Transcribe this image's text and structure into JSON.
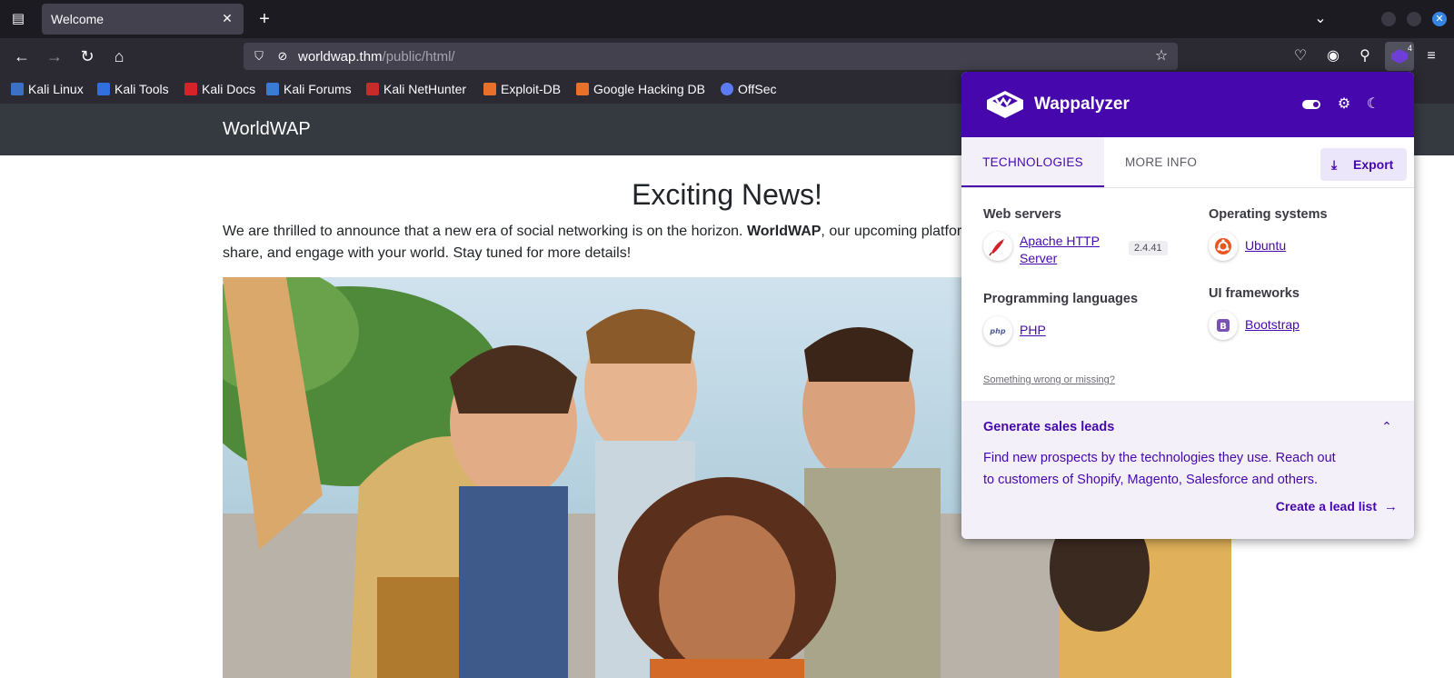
{
  "browser": {
    "tab_title": "Welcome",
    "url_host": "worldwap.thm",
    "url_path": "/public/html/",
    "extension_badge": "4",
    "bookmarks": [
      {
        "label": "Kali Linux",
        "icon": "kali-dragon-icon",
        "color": "#3c6fc6"
      },
      {
        "label": "Kali Tools",
        "icon": "kali-tools-icon",
        "color": "#2f6fe0"
      },
      {
        "label": "Kali Docs",
        "icon": "kali-docs-icon",
        "color": "#d6232a"
      },
      {
        "label": "Kali Forums",
        "icon": "kali-forums-icon",
        "color": "#3a7bd5"
      },
      {
        "label": "Kali NetHunter",
        "icon": "nethunter-icon",
        "color": "#c92a2a"
      },
      {
        "label": "Exploit-DB",
        "icon": "exploit-db-icon",
        "color": "#e8702a"
      },
      {
        "label": "Google Hacking DB",
        "icon": "ghdb-icon",
        "color": "#e8702a"
      },
      {
        "label": "OffSec",
        "icon": "offsec-icon",
        "color": "#5b7cf0"
      }
    ]
  },
  "site": {
    "brand": "WorldWAP",
    "headline": "Exciting News!",
    "para_part1": "We are thrilled to announce that a new era of social networking is on the horizon. ",
    "para_bold": "WorldWAP",
    "para_part2": ", our upcoming platform, will change the way you connect, share, and engage with your world. Stay tuned for more details!",
    "hero_image": "group-of-friends-selfie-photo"
  },
  "wappalyzer": {
    "brand": "Wappalyzer",
    "tabs": [
      "TECHNOLOGIES",
      "MORE INFO"
    ],
    "export_label": "Export",
    "categories": [
      {
        "title": "Web servers",
        "items": [
          {
            "name_line1": "Apache HTTP",
            "name_line2": "Server",
            "version": "2.4.41",
            "icon": "apache-feather-icon"
          }
        ]
      },
      {
        "title": "Operating systems",
        "items": [
          {
            "name": "Ubuntu",
            "icon": "ubuntu-icon"
          }
        ]
      },
      {
        "title": "Programming languages",
        "items": [
          {
            "name": "PHP",
            "icon": "php-icon"
          }
        ]
      },
      {
        "title": "UI frameworks",
        "items": [
          {
            "name": "Bootstrap",
            "icon": "bootstrap-icon"
          }
        ]
      }
    ],
    "wrong_link": "Something wrong or missing?",
    "leads": {
      "title": "Generate sales leads",
      "description": "Find new prospects by the technologies they use. Reach out to customers of Shopify, Magento, Salesforce and others.",
      "cta": "Create a lead list"
    },
    "accent_color": "#4608ad"
  }
}
